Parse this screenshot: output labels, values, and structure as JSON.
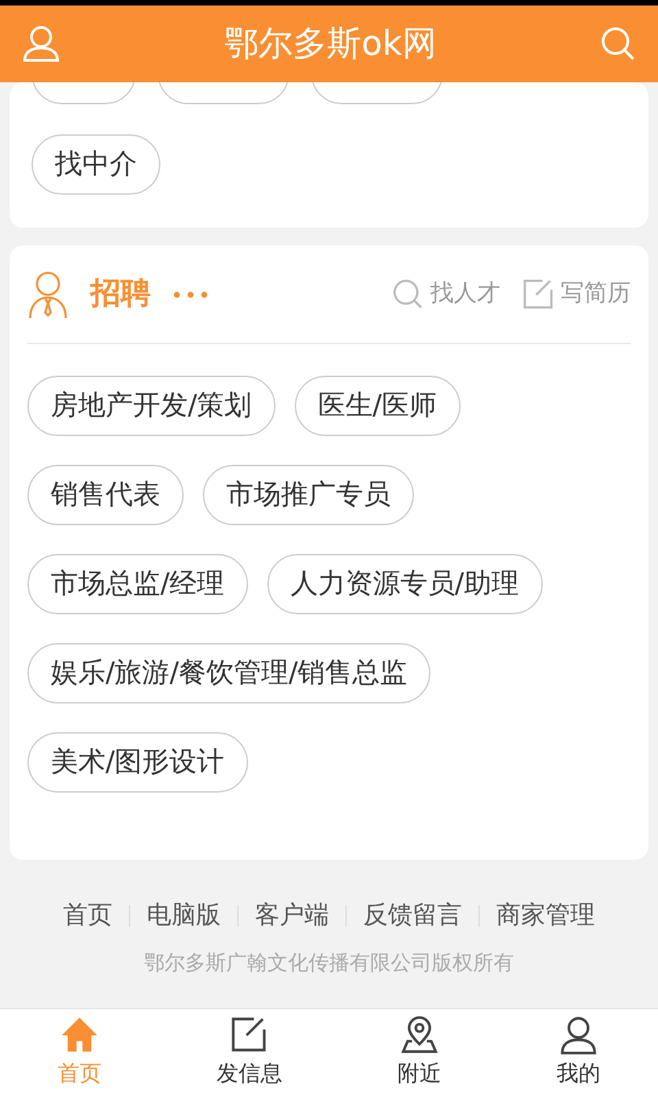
{
  "header": {
    "title": "鄂尔多斯ok网"
  },
  "housing": {
    "tags": [
      "找中介"
    ]
  },
  "jobs": {
    "title": "招聘",
    "actions": [
      {
        "kind": "search",
        "label": "找人才"
      },
      {
        "kind": "edit",
        "label": "写简历"
      }
    ],
    "tags": [
      "房地产开发/策划",
      "医生/医师",
      "销售代表",
      "市场推广专员",
      "市场总监/经理",
      "人力资源专员/助理",
      "娱乐/旅游/餐饮管理/销售总监",
      "美术/图形设计"
    ]
  },
  "footer": {
    "links": [
      "首页",
      "电脑版",
      "客户端",
      "反馈留言",
      "商家管理"
    ],
    "copyright": "鄂尔多斯广翰文化传播有限公司版权所有"
  },
  "tabbar": [
    {
      "kind": "home",
      "label": "首页",
      "selected": true
    },
    {
      "kind": "edit",
      "label": "发信息",
      "selected": false
    },
    {
      "kind": "pin",
      "label": "附近",
      "selected": false
    },
    {
      "kind": "user",
      "label": "我的",
      "selected": false
    }
  ]
}
